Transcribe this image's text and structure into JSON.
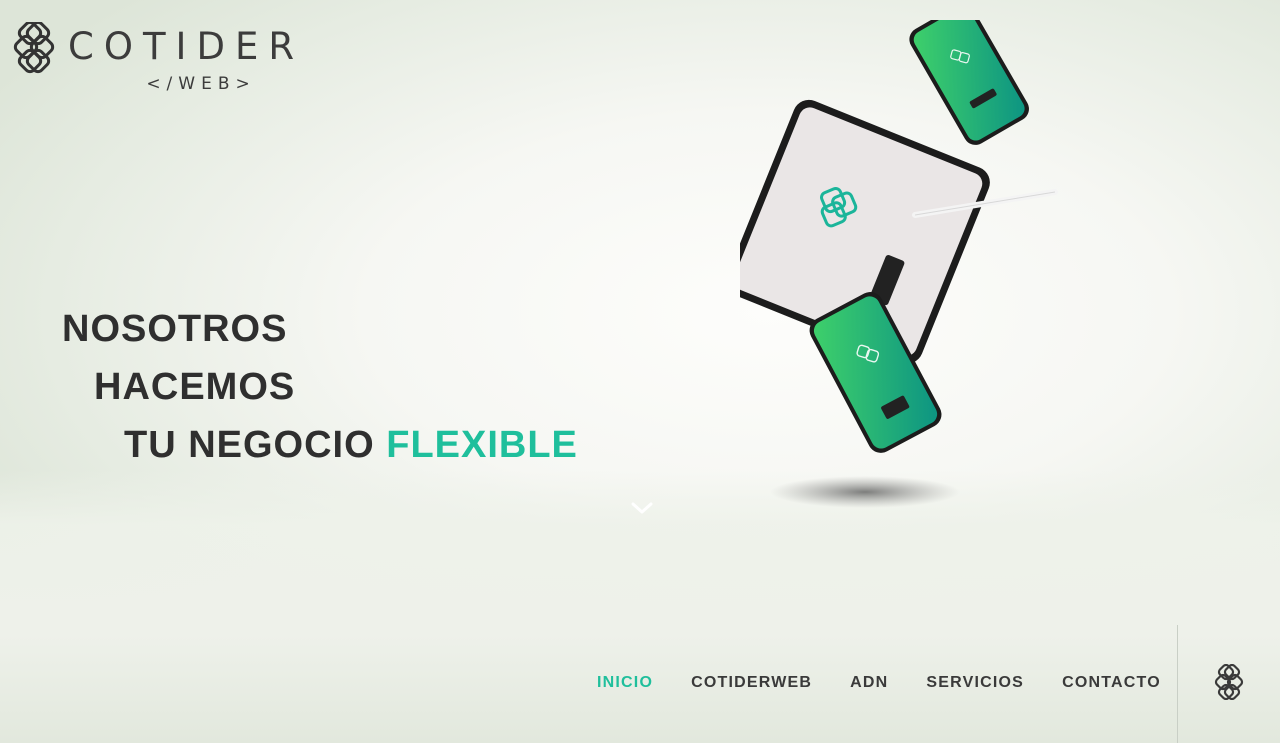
{
  "brand": {
    "name": "COTIDER",
    "sub": "</WEB>"
  },
  "hero": {
    "line1": "NOSOTROS",
    "line2": "HACEMOS",
    "line3_prefix": "TU NEGOCIO ",
    "line3_accent": "FLEXIBLE"
  },
  "nav": {
    "items": [
      {
        "label": "INICIO",
        "active": true
      },
      {
        "label": "COTIDERWEB",
        "active": false
      },
      {
        "label": "ADN",
        "active": false
      },
      {
        "label": "SERVICIOS",
        "active": false
      },
      {
        "label": "CONTACTO",
        "active": false
      }
    ]
  },
  "icons": {
    "logo": "knot-logo-icon",
    "scroll": "chevron-down-icon"
  },
  "colors": {
    "accent": "#1fbf9c",
    "text": "#2f2f2f",
    "device_green_start": "#2fd06e",
    "device_green_end": "#0d9a86"
  }
}
